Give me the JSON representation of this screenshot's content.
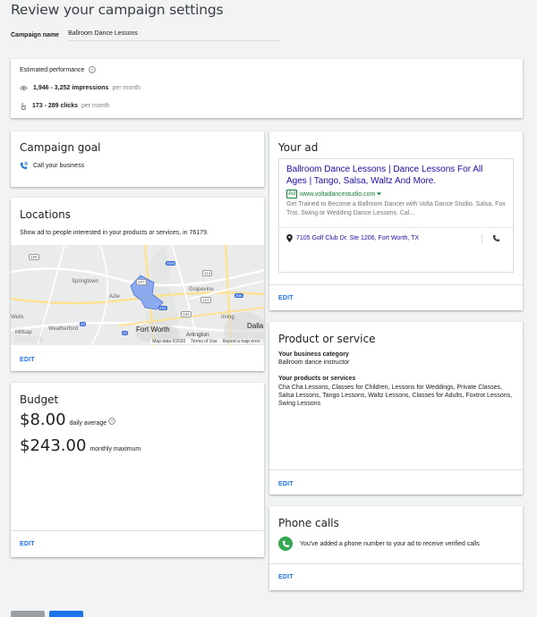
{
  "page": {
    "title": "Review your campaign settings"
  },
  "campaign": {
    "name_label": "Campaign name",
    "name_value": "Ballroom Dance Lessons"
  },
  "performance": {
    "title": "Estimated performance",
    "impressions": "1,946 - 3,252 impressions",
    "impressions_unit": "per month",
    "clicks": "173 - 289 clicks",
    "clicks_unit": "per month"
  },
  "goal": {
    "title": "Campaign goal",
    "item": "Call your business"
  },
  "locations": {
    "title": "Locations",
    "description": "Show ad to people interested in your products or services, in 76179.",
    "map": {
      "places": [
        "Springtown",
        "Azle",
        "Grapevine",
        "Irving",
        "Weatherford",
        "Fort Worth",
        "Arlington",
        "Dalla",
        "Millsap",
        "Weils"
      ],
      "highway_shields": [
        "287",
        "199",
        "35W",
        "114",
        "121",
        "183",
        "820",
        "30",
        "35E",
        "20"
      ],
      "brand": "Google",
      "footer": [
        "Map data ©2020",
        "Terms of Use",
        "Report a map error"
      ]
    },
    "edit": "EDIT"
  },
  "budget": {
    "title": "Budget",
    "daily_amount": "$8.00",
    "daily_label": "daily average",
    "monthly_amount": "$243.00",
    "monthly_label": "monthly maximum",
    "edit": "EDIT"
  },
  "ad": {
    "title": "Your ad",
    "headline": "Ballroom Dance Lessons | Dance Lessons For All Ages | Tango, Salsa, Waltz And More.",
    "badge": "Ad",
    "url": "www.voltadancestudio.com",
    "description": "Get Trained to Become a Ballroom Dancer with Volta Dance Studio. Salsa, Fox Trot, Swing or Wedding Dance Lessons. Cal...",
    "address": "7105 Golf Club Dr. Ste 1206, Fort Worth, TX",
    "edit": "EDIT"
  },
  "product": {
    "title": "Product or service",
    "category_label": "Your business category",
    "category_value": "Ballroom dance instructor",
    "products_label": "Your products or services",
    "products_value": "Cha Cha Lessons, Classes for Children, Lessons for Weddings, Private Classes, Salsa Lessons, Tango Lessons, Waltz Lessons, Classes for Adults, Foxtrot Lessons, Swing Lessons",
    "edit": "EDIT"
  },
  "phone": {
    "title": "Phone calls",
    "text": "You've added a phone number to your ad to receive verified calls",
    "edit": "EDIT"
  },
  "colors": {
    "accent": "#1a73e8",
    "headline": "#1a0dab",
    "url": "#188038",
    "phone_green": "#34a853",
    "map_area": "#7b9ff2"
  }
}
